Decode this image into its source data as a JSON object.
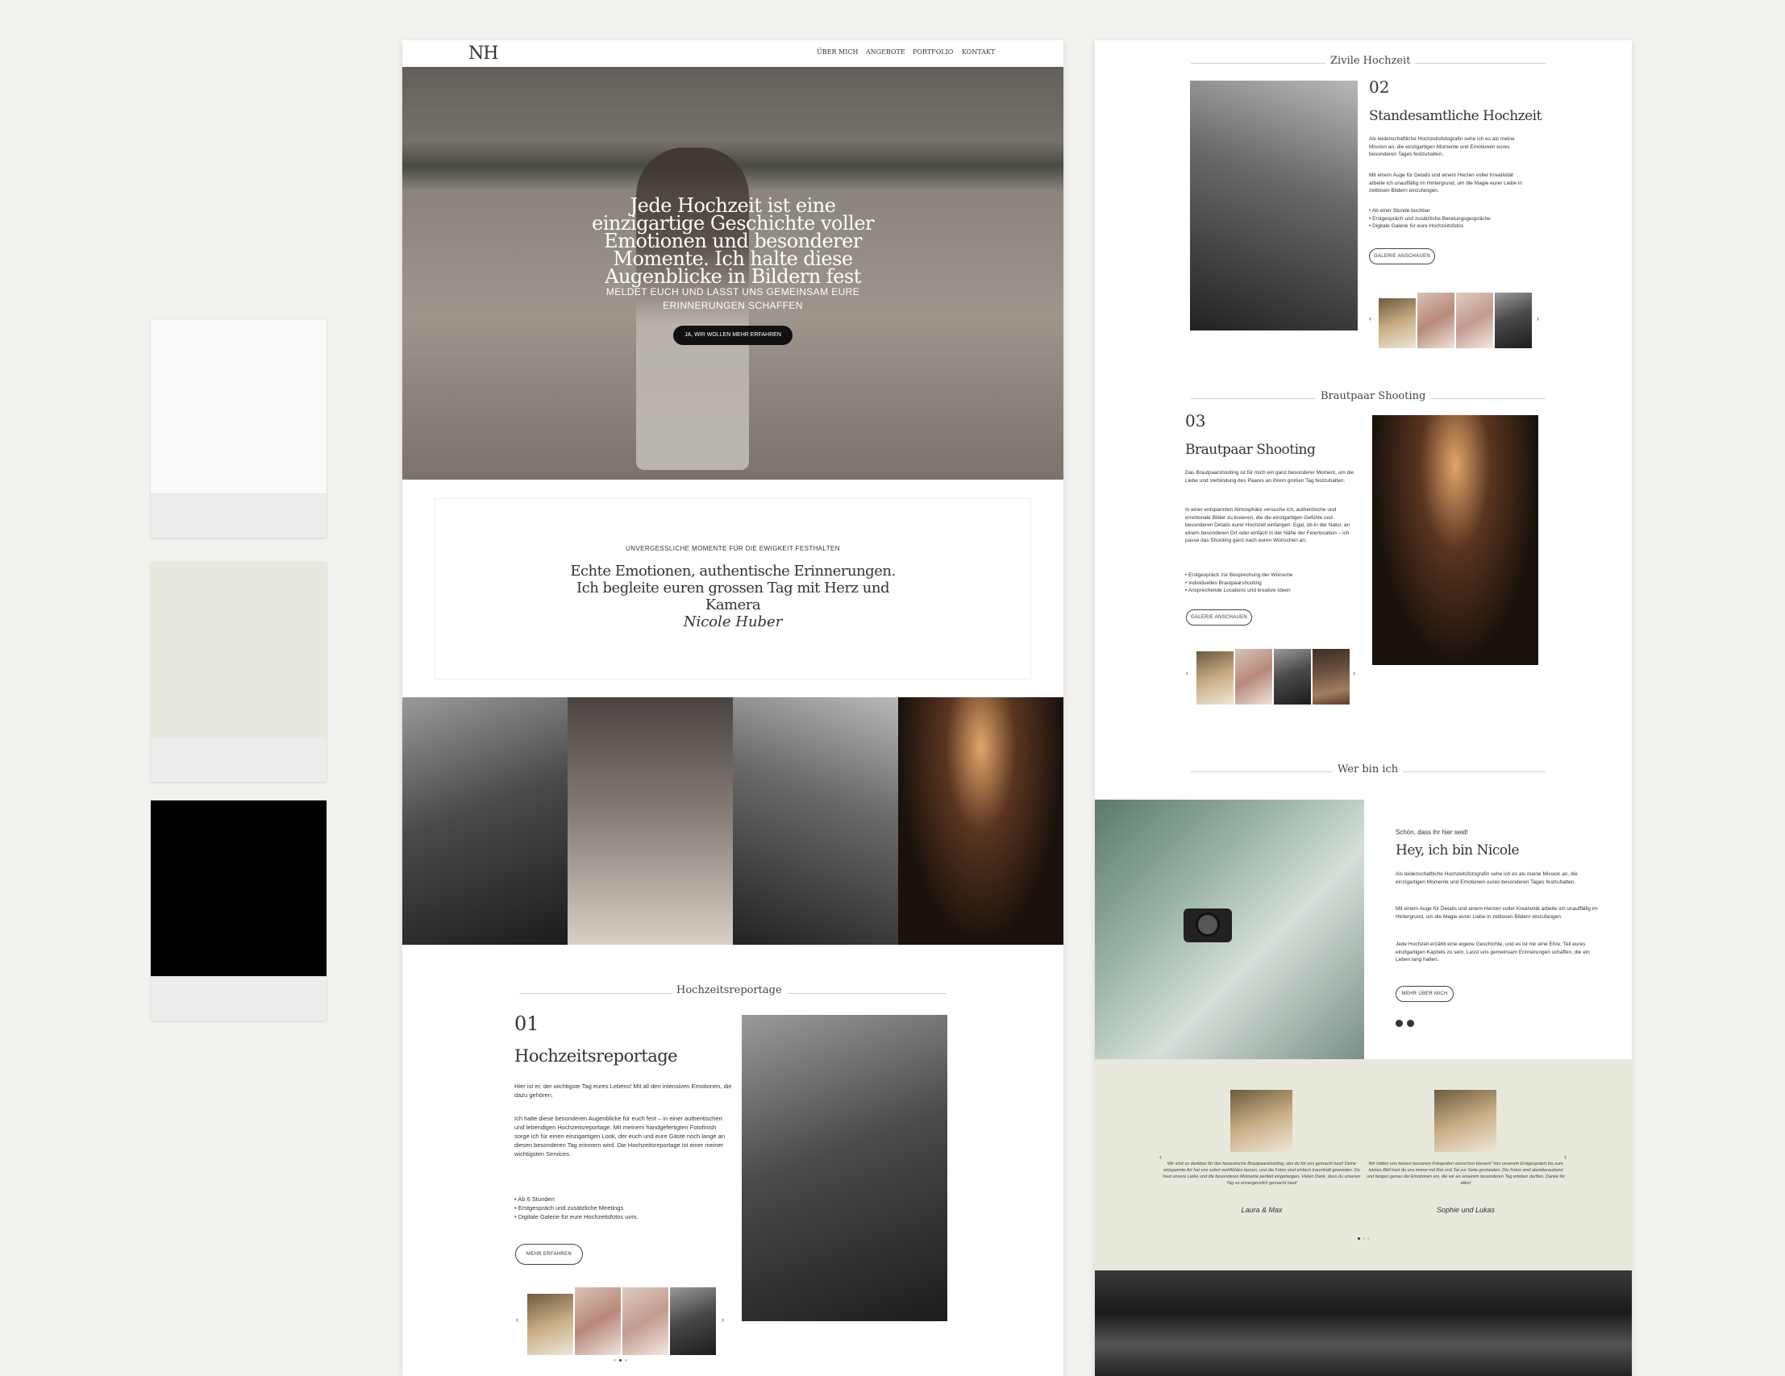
{
  "colors": {
    "background": "#f3f2ee",
    "swatch_white": "#fafafa",
    "swatch_beige": "#e9e8de",
    "swatch_black": "#000000",
    "testimonial_bg": "#e9e8dc"
  },
  "left": {
    "logo": "N H",
    "nav": [
      "ÜBER MICH",
      "ANGEBOTE",
      "PORTFOLIO",
      "KONTAKT"
    ],
    "hero": {
      "headline": "Jede Hochzeit ist eine einzigartige Geschichte voller Emotionen und besonderer Momente. Ich halte diese Augenblicke in Bildern fest",
      "sub": "MELDET EUCH UND LASST UNS GEMEINSAM EURE ERINNERUNGEN SCHAFFEN",
      "cta": "JA, WIR WOLLEN MEHR ERFAHREN"
    },
    "intro": {
      "kicker": "UNVERGESSLICHE MOMENTE FÜR DIE EWIGKEIT FESTHALTEN",
      "title": "Echte Emotionen, authentische Erinnerungen. Ich begleite euren grossen Tag mit Herz und Kamera",
      "signature": "Nicole Huber"
    },
    "section": {
      "title": "Hochzeitsreportage",
      "number": "01",
      "heading": "Hochzeitsreportage",
      "p1": "Hier ist er, der wichtigste Tag eures Lebens! Mit all den intensiven Emotionen, die dazu gehören.",
      "p2": "Ich halte diese besonderen Augenblicke für euch fest – in einer authentischen und lebendigen Hochzeitsreportage. Mit meinem handgefertigten Fotofinish sorge ich für einen einzigartigen Look, der euch und eure Gäste noch lange an diesen besonderen Tag erinnern wird. Die Hochzeitsreportage ist einer meiner wichtigsten Services.",
      "bullets": [
        "Ab 6 Stunden",
        "Erstgespräch und zusätzliche Meetings",
        "Digitale Galerie für eure Hochzeitsfotos uvm."
      ],
      "button": "MEHR ERFAHREN",
      "prev": "‹",
      "next": "›"
    }
  },
  "right": {
    "s2": {
      "title": "Zivile Hochzeit",
      "number": "02",
      "heading": "Standesamtliche Hochzeit",
      "p1": "Als leidenschaftliche Hochzeitsfotografin sehe ich es als meine Mission an, die einzigartigen Momente und Emotionen eures besonderen Tages festzuhalten.",
      "p2": "Mit einem Auge für Details und einem Herzen voller Kreativität arbeite ich unauffällig im Hintergrund, um die Magie eurer Liebe in zeitlosen Bildern einzufangen.",
      "bullets": [
        "Ab einer Stunde buchbar",
        "Erstgespräch und zusätzliche Beratungsgespräche",
        "Digitale Galerie für eure Hochzeitsfotos"
      ],
      "button": "GALERIE ANSCHAUEN",
      "prev": "‹",
      "next": "›"
    },
    "s3": {
      "title": "Brautpaar Shooting",
      "number": "03",
      "heading": "Brautpaar Shooting",
      "p1": "Das Brautpaarshooting ist für mich ein ganz besonderer Moment, um die Liebe und Verbindung des Paares an ihrem großen Tag festzuhalten.",
      "p2": "In einer entspannten Atmosphäre versuche ich, authentische und emotionale Bilder zu kreieren, die die einzigartigen Gefühle und besonderen Details eurer Hochzeit einfangen. Egal, ob in der Natur, an einem besonderen Ort oder einfach in der Nähe der Feierlocation – ich passe das Shooting ganz nach euren Wünschen an.",
      "bullets": [
        "Erstgespräch zur Besprechung der Wünsche",
        "Individuelles Brautpaarshooting",
        "Ansprechende Locations und kreative Ideen"
      ],
      "button": "GALERIE ANSCHAUEN",
      "prev": "‹",
      "next": "›"
    },
    "about": {
      "title": "Wer bin ich",
      "kicker": "Schön, dass ihr hier seid!",
      "heading": "Hey, ich bin Nicole",
      "p1": "Als leidenschaftliche Hochzeitsfotografin sehe ich es als meine Mission an, die einzigartigen Momente und Emotionen eures besonderen Tages festzuhalten.",
      "p2": "Mit einem Auge für Details und einem Herzen voller Kreativität arbeite ich unauffällig im Hintergrund, um die Magie eurer Liebe in zeitlosen Bildern einzufangen.",
      "p3": "Jede Hochzeit erzählt eine eigene Geschichte, und es ist mir eine Ehre, Teil eures einzigartigen Kapitels zu sein. Lasst uns gemeinsam Erinnerungen schaffen, die ein Leben lang halten.",
      "button": "MEHR ÜBER MICH"
    },
    "testimonials": [
      {
        "quote": "Wir sind so dankbar für das fantastische Brautpaarshooting, das du für uns gemacht hast! Deine entspannte Art hat uns sofort wohlfühlen lassen, und die Fotos sind einfach traumhaft geworden. Du hast unsere Liebe und die besonderen Momente perfekt eingefangen. Vielen Dank, dass du unseren Tag so unvergesslich gemacht hast!",
        "name": "Laura & Max"
      },
      {
        "quote": "Wir hätten uns keinen besseren Fotografen wünschen können! Von unserem Erstgespräch bis zum letzten Bild hast du uns immer mit Rat und Tat zur Seite gestanden. Die Fotos sind atemberaubend und fangen genau die Emotionen ein, die wir an unserem besonderen Tag erleben durften. Danke für alles!",
        "name": "Sophie und Lukas"
      }
    ],
    "t_prev": "‹",
    "t_next": "›"
  }
}
